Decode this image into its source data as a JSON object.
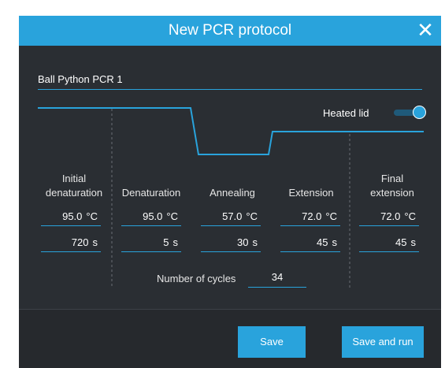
{
  "dialog": {
    "title": "New PCR protocol",
    "close_icon": "close-icon",
    "accent_color": "#29a3dc",
    "background_color": "#2a2e33"
  },
  "protocol_name": {
    "value": "Ball Python PCR 1"
  },
  "heated_lid": {
    "label": "Heated lid",
    "enabled": true
  },
  "steps": [
    {
      "label_line1": "Initial",
      "label_line2": "denaturation",
      "temperature": "95.0",
      "temp_unit": "°C",
      "time": "720",
      "time_unit": "s"
    },
    {
      "label_line1": "",
      "label_line2": "Denaturation",
      "temperature": "95.0",
      "temp_unit": "°C",
      "time": "5",
      "time_unit": "s"
    },
    {
      "label_line1": "",
      "label_line2": "Annealing",
      "temperature": "57.0",
      "temp_unit": "°C",
      "time": "30",
      "time_unit": "s"
    },
    {
      "label_line1": "",
      "label_line2": "Extension",
      "temperature": "72.0",
      "temp_unit": "°C",
      "time": "45",
      "time_unit": "s"
    },
    {
      "label_line1": "Final",
      "label_line2": "extension",
      "temperature": "72.0",
      "temp_unit": "°C",
      "time": "45",
      "time_unit": "s"
    }
  ],
  "cycles": {
    "label": "Number of cycles",
    "value": "34"
  },
  "buttons": {
    "save": "Save",
    "save_and_run": "Save and run"
  }
}
